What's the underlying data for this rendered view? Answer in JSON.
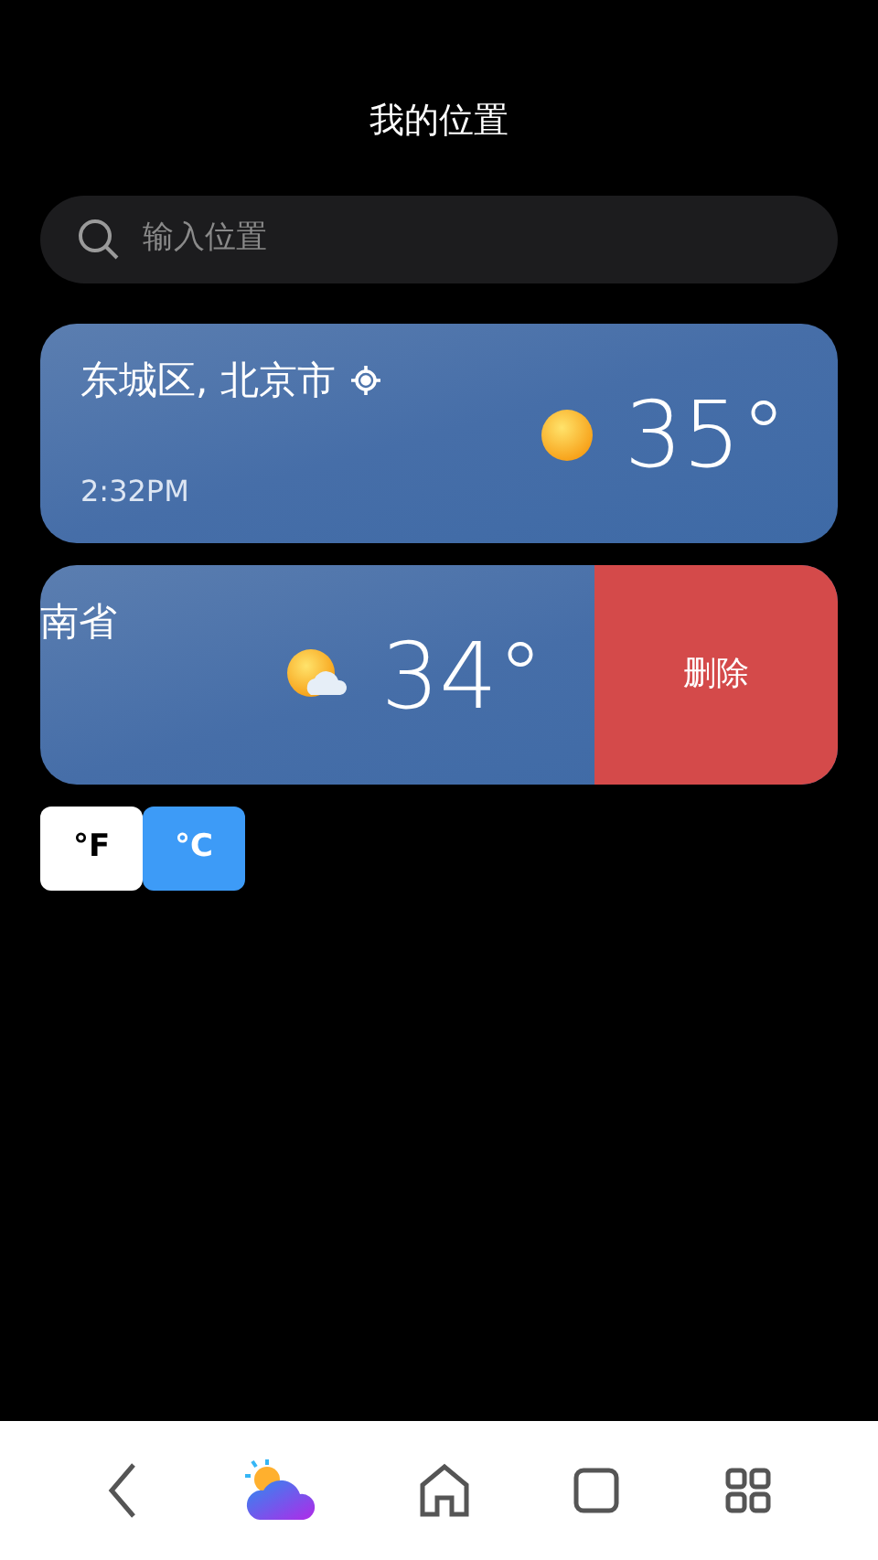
{
  "title": "我的位置",
  "search": {
    "placeholder": "输入位置"
  },
  "locations": [
    {
      "name": "东城区, 北京市",
      "current": true,
      "time": "2:32PM",
      "kind": "sunny",
      "temp": "35°",
      "swiped": false
    },
    {
      "name": "南省",
      "current": false,
      "kind": "partly-cloudy",
      "temp": "34°",
      "swiped": true,
      "delete_label": "删除"
    }
  ],
  "units": [
    {
      "label": "°F",
      "selected": false
    },
    {
      "label": "°C",
      "selected": true
    }
  ]
}
